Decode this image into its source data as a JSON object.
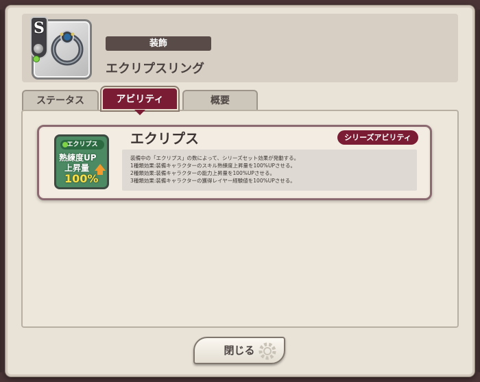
{
  "item": {
    "rank": "S",
    "category": "装飾",
    "name": "エクリプスリング",
    "icon": "ring-icon"
  },
  "tabs": [
    {
      "label": "ステータス",
      "active": false
    },
    {
      "label": "アビリティ",
      "active": true
    },
    {
      "label": "概要",
      "active": false
    }
  ],
  "ability": {
    "name": "エクリプス",
    "series_badge": "シリーズアビリティ",
    "icon": {
      "tag": "エクリプス",
      "line1": "熟練度UP",
      "line2": "上昇量",
      "line3": "100%"
    },
    "description": [
      "装備中の「エクリプス」の数によって、シリーズセット効果が発動する。",
      "1種類効果:装備キャラクターのスキル熟練度上昇量を100%UPさせる。",
      "2種類効果:装備キャラクターの能力上昇量を100%UPさせる。",
      "3種類効果:装備キャラクターの獲得レイヤー経験値を100%UPさせる。"
    ]
  },
  "footer": {
    "close_label": "閉じる"
  },
  "colors": {
    "accent": "#7a1c34",
    "panel": "#e9e2d7"
  }
}
